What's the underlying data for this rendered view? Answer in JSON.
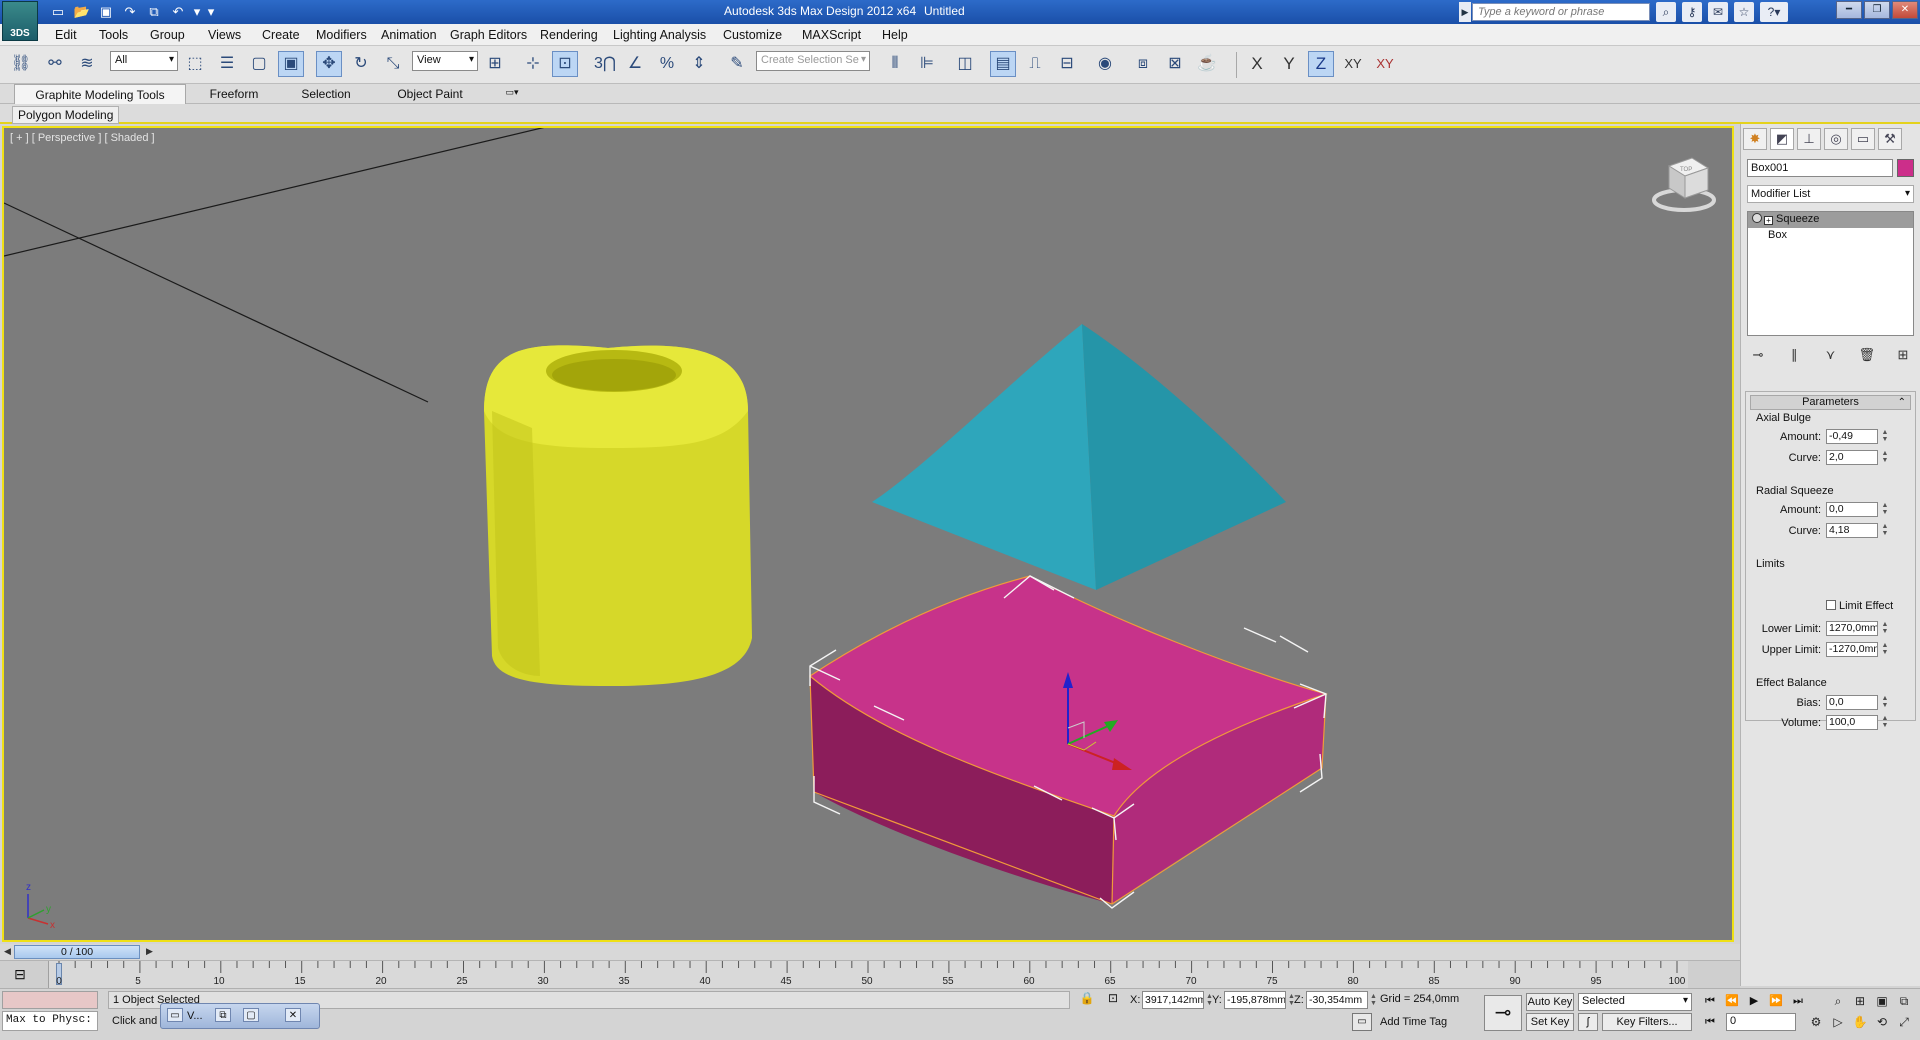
{
  "titlebar": {
    "logo": "3DS",
    "title": "Autodesk 3ds Max Design 2012 x64",
    "document": "Untitled",
    "search_placeholder": "Type a keyword or phrase"
  },
  "menu": [
    "Edit",
    "Tools",
    "Group",
    "Views",
    "Create",
    "Modifiers",
    "Animation",
    "Graph Editors",
    "Rendering",
    "Lighting Analysis",
    "Customize",
    "MAXScript",
    "Help"
  ],
  "toolbar": {
    "selection_filter": "All",
    "ref_coord": "View",
    "named_selection_placeholder": "Create Selection Se",
    "axis": [
      "X",
      "Y",
      "Z",
      "XY",
      "XY"
    ],
    "active_axis": "Z"
  },
  "ribbon": {
    "tabs": [
      "Graphite Modeling Tools",
      "Freeform",
      "Selection",
      "Object Paint"
    ],
    "active_tab": "Graphite Modeling Tools",
    "panel_label": "Polygon Modeling"
  },
  "viewport": {
    "label": "[ + ] [ Perspective ] [ Shaded ]",
    "viewcube_face": "TOP",
    "axis_labels": {
      "x": "x",
      "y": "y",
      "z": "z"
    },
    "colors": {
      "background": "#7c7c7c",
      "border": "#efe015",
      "cylinder": "#d6d829",
      "pyramid": "#2ea6bb",
      "box": "#c22e82"
    }
  },
  "command_panel": {
    "object_name": "Box001",
    "object_color": "#cc2e8a",
    "modifier_list": "Modifier List",
    "stack": [
      "Squeeze",
      "Box"
    ],
    "rollout_title": "Parameters",
    "axial_bulge": {
      "label": "Axial Bulge",
      "amount_label": "Amount:",
      "amount": "-0,49",
      "curve_label": "Curve:",
      "curve": "2,0"
    },
    "radial_squeeze": {
      "label": "Radial Squeeze",
      "amount_label": "Amount:",
      "amount": "0,0",
      "curve_label": "Curve:",
      "curve": "4,18"
    },
    "limits": {
      "label": "Limits",
      "limit_effect": "Limit Effect",
      "lower_label": "Lower Limit:",
      "lower": "1270,0mm",
      "upper_label": "Upper Limit:",
      "upper": "-1270,0mm"
    },
    "effect_balance": {
      "label": "Effect Balance",
      "bias_label": "Bias:",
      "bias": "0,0",
      "volume_label": "Volume:",
      "volume": "100,0"
    }
  },
  "timeline": {
    "frame_display": "0 / 100",
    "ticks": [
      "5",
      "10",
      "15",
      "20",
      "25",
      "30",
      "35",
      "40",
      "45",
      "50",
      "55",
      "60",
      "65",
      "70",
      "75",
      "80",
      "85",
      "90",
      "95",
      "100"
    ],
    "marker": "0"
  },
  "status": {
    "maxscript_text": "Max to Physc:",
    "selection": "1 Object Selected",
    "prompt": "Click and d",
    "task_button": "V...",
    "x_label": "X:",
    "x": "3917,142mm",
    "y_label": "Y:",
    "y": "-195,878mm",
    "z_label": "Z:",
    "z": "-30,354mm",
    "grid": "Grid = 254,0mm",
    "add_time_tag": "Add Time Tag",
    "auto_key": "Auto Key",
    "set_key": "Set Key",
    "key_mode": "Selected",
    "key_filters": "Key Filters...",
    "frame": "0"
  }
}
